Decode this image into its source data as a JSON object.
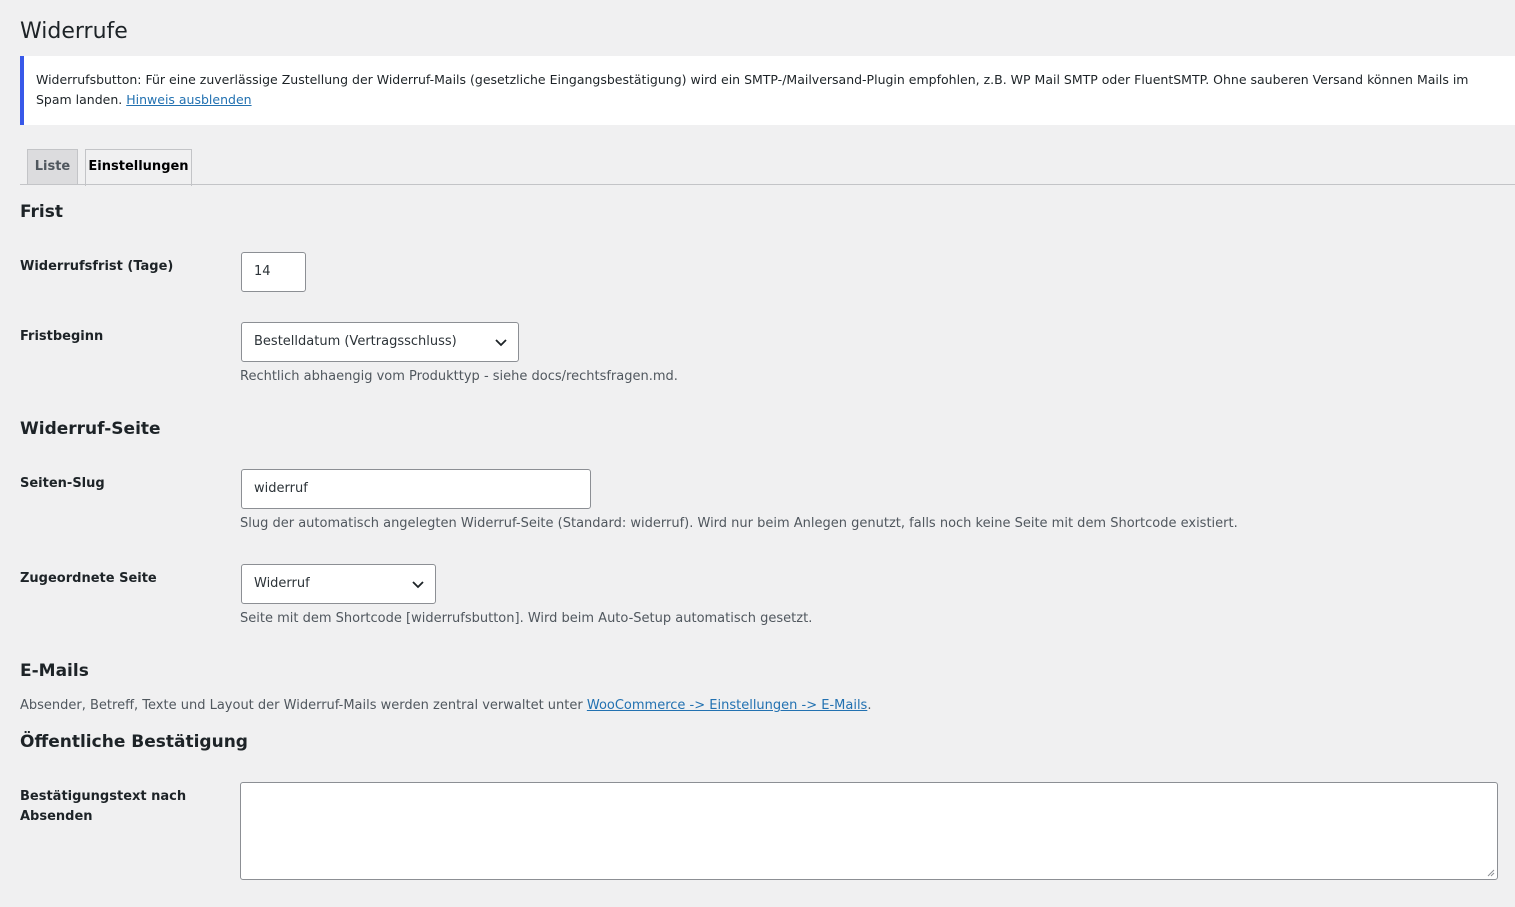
{
  "page": {
    "title": "Widerrufe"
  },
  "notice": {
    "text": "Widerrufsbutton: Für eine zuverlässige Zustellung der Widerruf-Mails (gesetzliche Eingangsbestätigung) wird ein SMTP-/Mailversand-Plugin empfohlen, z.B. WP Mail SMTP oder FluentSMTP. Ohne sauberen Versand können Mails im Spam landen. ",
    "link_text": "Hinweis ausblenden"
  },
  "tabs": [
    {
      "label": "Liste",
      "active": false
    },
    {
      "label": "Einstellungen",
      "active": true
    }
  ],
  "sections": {
    "frist": {
      "heading": "Frist",
      "widerrufsfrist_label": "Widerrufsfrist (Tage)",
      "widerrufsfrist_value": "14",
      "fristbeginn_label": "Fristbeginn",
      "fristbeginn_value": "Bestelldatum (Vertragsschluss)",
      "fristbeginn_desc": "Rechtlich abhaengig vom Produkttyp - siehe docs/rechtsfragen.md."
    },
    "seite": {
      "heading": "Widerruf-Seite",
      "slug_label": "Seiten-Slug",
      "slug_value": "widerruf",
      "slug_desc": "Slug der automatisch angelegten Widerruf-Seite (Standard: widerruf). Wird nur beim Anlegen genutzt, falls noch keine Seite mit dem Shortcode existiert.",
      "zugeordnet_label": "Zugeordnete Seite",
      "zugeordnet_value": "Widerruf",
      "zugeordnet_desc": "Seite mit dem Shortcode [widerrufsbutton]. Wird beim Auto-Setup automatisch gesetzt."
    },
    "emails": {
      "heading": "E-Mails",
      "desc_prefix": "Absender, Betreff, Texte und Layout der Widerruf-Mails werden zentral verwaltet unter ",
      "desc_link": "WooCommerce -> Einstellungen -> E-Mails",
      "desc_suffix": "."
    },
    "bestaetigung": {
      "heading": "Öffentliche Bestätigung",
      "text_label": "Bestätigungstext nach Absenden",
      "text_value": ""
    }
  },
  "colors": {
    "accent": "#3858e9",
    "link": "#2271b1",
    "background": "#f0f0f1"
  },
  "icons": {
    "select_arrow": "chevron-down-icon",
    "resize": "resize-grip-icon"
  }
}
